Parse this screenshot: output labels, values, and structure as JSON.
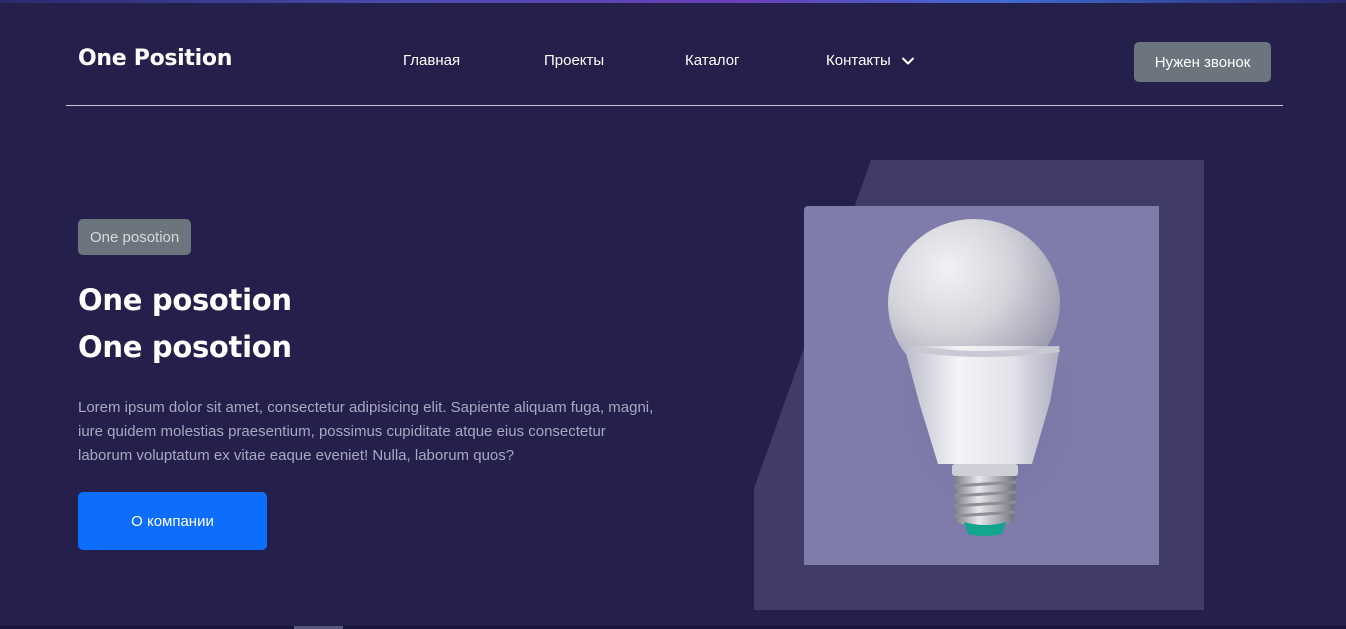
{
  "header": {
    "brand": "One Position",
    "nav": [
      {
        "label": "Главная"
      },
      {
        "label": "Проекты"
      },
      {
        "label": "Каталог"
      },
      {
        "label": "Контакты",
        "has_dropdown": true,
        "icon": "chevron-down-icon"
      }
    ],
    "call_button": "Нужен звонок"
  },
  "hero": {
    "badge": "One posotion",
    "title_line1": "One posotion",
    "title_line2": "One posotion",
    "lead": "Lorem ipsum dolor sit amet, consectetur adipisicing elit. Sapiente aliquam fuga, magni, iure quidem molestias praesentium, possimus cupiditate atque eius consectetur laborum voluptatum ex vitae eaque eveniet! Nulla, laborum quos?",
    "cta_button": "О компании",
    "image": {
      "subject": "light-bulb",
      "icon": "light-bulb-image"
    }
  },
  "colors": {
    "background": "#24204b",
    "primary": "#0d6efd",
    "secondary": "#6c757d",
    "photo_bg": "#7f7cab",
    "deco": "#413c67",
    "lead_text": "#a9a7c4"
  }
}
